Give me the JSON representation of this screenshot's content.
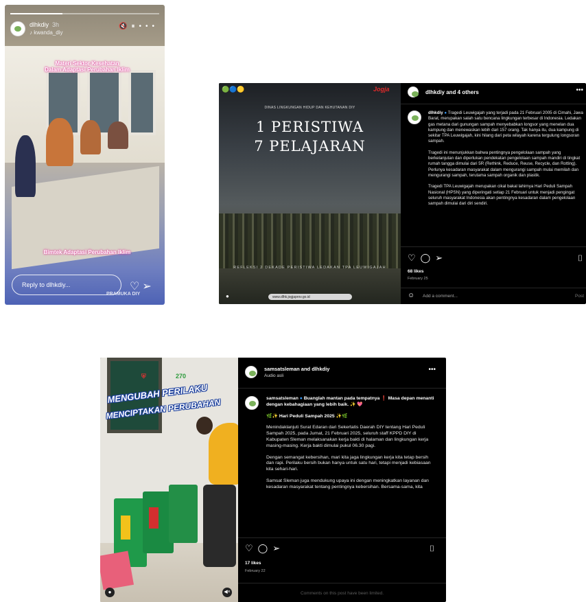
{
  "story": {
    "username": "dlhkdiy",
    "time": "3h",
    "music": "kwanda_diy",
    "caption_top_line1": "Materi Sektor Kesehatan",
    "caption_top_line2": "Dalam Adaptasi Perubahan Iklim",
    "caption_bottom": "Bimtek Adaptasi Perubahan Iklim",
    "reply_placeholder": "Reply to dlhkdiy...",
    "watermark": "PRAMUKA DIY"
  },
  "post1": {
    "header_user": "dlhkdiy and 4 others",
    "image": {
      "top_small": "DINAS LINGKUNGAN HIDUP DAN KEHUTANAN DIY",
      "title_line1": "1 PERISTIWA",
      "title_line2": "7 PELAJARAN",
      "subtitle": "REFLEKSI 2 DEKADE PERISTIWA LEDAKAN TPA LEUWIGAJAH",
      "url_bar": "www.dlhk.jogjaprov.go.id",
      "brand": "Jogja"
    },
    "caption_user": "dlhkdiy",
    "caption_p1": "Tragedi Leuwigajah yang terjadi pada 21 Februari 2005 di Cimahi, Jawa Barat, merupakan salah satu bencana lingkungan terbesar di Indonesia. Ledakan gas metana dari gunungan sampah menyebabkan longsor yang menelan dua kampung dan menewaskan lebih dari 157 orang. Tak hanya itu, dua kampung di sekitar TPA Leuwigajah, kini hilang dari peta wilayah karena tergulung longsoran sampah.",
    "caption_p2": "Tragedi ini menunjukkan bahwa pentingnya pengelolaan sampah yang berkelanjutan dan diperlukan pendekatan pengelolaan sampah mandiri di tingkat rumah tangga dimulai dari 5R (Rethink, Reduce, Reuse, Recycle, dan Rotting). Perlunya kesadaran masyarakat dalam mengurangi sampah mulai memilah dan mengurangi sampah, terutama sampah organik dan plastik.",
    "caption_p3": "Tragedi TPA Leuwigajah merupakan cikal bakal lahirnya Hari Peduli Sampah Nasional (HPSN) yang diperingati setiap 21 Februari untuk menjadi pengingat seluruh masyarakat Indonesia akan pentingnya kesadaran dalam pengelolaan sampah dimulai dari diri sendiri.",
    "likes": "68 likes",
    "date": "February 25",
    "comment_placeholder": "Add a comment...",
    "post_label": "Post"
  },
  "post2": {
    "header_user": "samsatsleman and dlhkdiy",
    "audio": "Audio asli",
    "image": {
      "text_line1": "MENGUBAH PERILAKU",
      "text_line2": "MENCIPTAKAN PERUBAHAN",
      "anniv": "270"
    },
    "caption_user": "samsatsleman",
    "caption_intro": "Buanglah mantan pada tempatnya ❗ Masa depan menanti dengan kebahagiaan yang lebih baik. ✨ 💖",
    "caption_heading": "🌿✨ Hari Peduli Sampah 2025 ✨🌿",
    "caption_p1": "Menindaklanjuti Surat Edaran dari Sekertatis Daerah DIY tentang Hari Peduli Sampah 2025, pada Jumat, 21 Februari 2025, seluruh staff KPPD DIY di Kabupaten Sleman melaksanakan kerja bakti di halaman dan lingkungan kerja masing-masing. Kerja bakti dimulai pukul 06.30 pagi.",
    "caption_p2": "Dengan semangat kebersihan, mari kita jaga lingkungan kerja kita tetap bersih dan rapi. Perilaku bersih bukan hanya untuk satu hari, tetapi menjadi kebiasaan kita sehari-hari.",
    "caption_p3": "Samsat Sleman juga mendukung upaya ini dengan meningkatkan layanan dan kesadaran masyarakat tentang pentingnya kebersihan. Bersama-sama, kita wujudkan Sleman yang lebih bersih dan tertib.",
    "likes": "17 likes",
    "date": "February 22",
    "comments_limited": "Comments on this post have been limited."
  },
  "icons": {
    "more": "more-horizontal-icon",
    "heart": "heart-icon",
    "comment": "comment-icon",
    "share": "send-icon",
    "bookmark": "bookmark-icon",
    "emoji": "emoji-icon",
    "mute": "mute-icon",
    "pause": "pause-icon",
    "user": "user-tag-icon"
  },
  "colors": {
    "instagram_bg": "#000000",
    "verified": "#3897f0",
    "caption_glow": "#e0389a",
    "bin_green": "#1f9a4a"
  }
}
